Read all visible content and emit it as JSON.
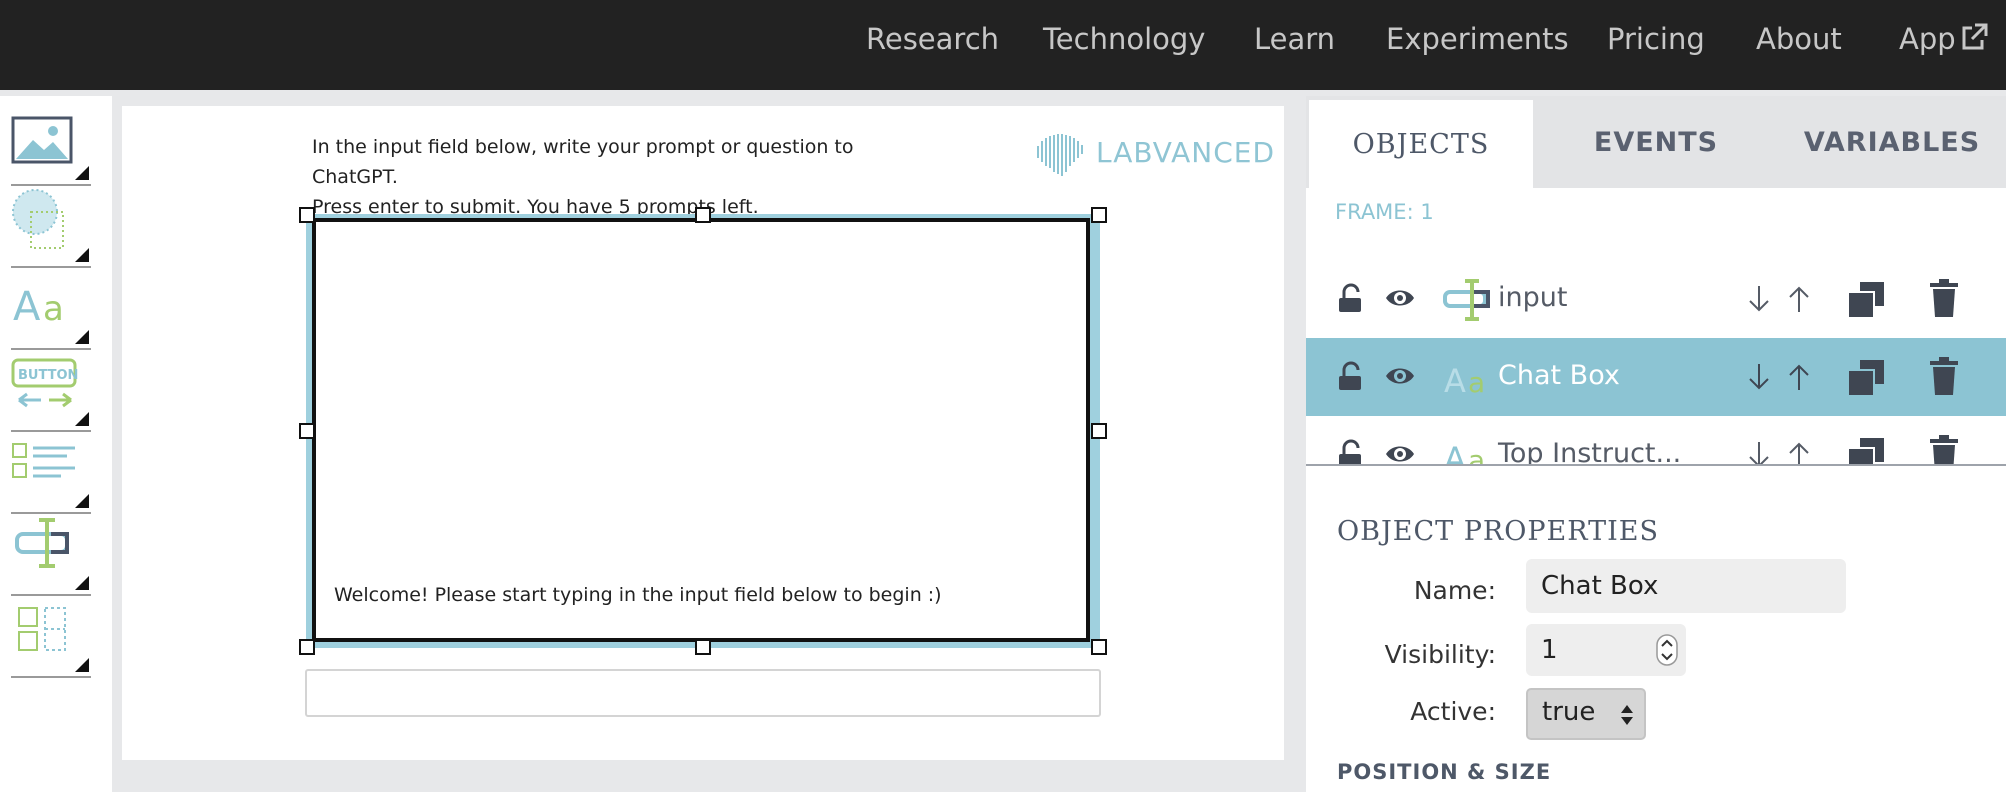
{
  "nav": {
    "items": [
      "Research",
      "Technology",
      "Learn",
      "Experiments",
      "Pricing",
      "About",
      "App"
    ]
  },
  "toolbar": {
    "tools": [
      "image-tool-icon",
      "shape-tool-icon",
      "text-tool-icon",
      "button-tool-icon",
      "list-tool-icon",
      "input-tool-icon",
      "layout-tool-icon"
    ]
  },
  "canvas": {
    "instructions_line1": "In the input field below, write your prompt or question to ChatGPT.",
    "instructions_line2": "Press enter to submit. You have 5 prompts left.",
    "logo_text": "LABVANCED",
    "chat_welcome": "Welcome! Please start typing in the input field below to begin :)",
    "input_value": ""
  },
  "panel": {
    "tabs": [
      "OBJECTS",
      "EVENTS",
      "VARIABLES"
    ],
    "active_tab": "OBJECTS",
    "frame_label": "FRAME: 1",
    "objects": [
      {
        "name": "input",
        "type": "input"
      },
      {
        "name": "Chat Box",
        "type": "text",
        "selected": true
      },
      {
        "name": "Top Instruct...",
        "type": "text"
      }
    ],
    "properties_title": "OBJECT PROPERTIES",
    "name_label": "Name:",
    "name_value": "Chat Box",
    "visibility_label": "Visibility:",
    "visibility_value": "1",
    "active_label": "Active:",
    "active_value": "true",
    "position_size_label": "POSITION & SIZE"
  },
  "colors": {
    "accent": "#8cc4d3",
    "green": "#a3cc6f",
    "nav_bg": "#222222"
  }
}
